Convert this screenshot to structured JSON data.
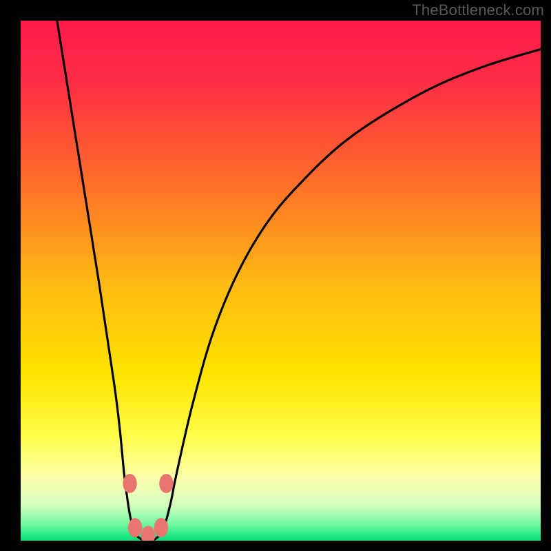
{
  "watermark": "TheBottleneck.com",
  "chart_data": {
    "type": "line",
    "title": "",
    "xlabel": "",
    "ylabel": "",
    "xlim": [
      0,
      100
    ],
    "ylim": [
      0,
      100
    ],
    "grid": false,
    "series": [
      {
        "name": "curve",
        "x": [
          7.0,
          11.0,
          15.0,
          18.0,
          19.0,
          19.5,
          20.0,
          21.0,
          22.0,
          23.0,
          24.0,
          25.0,
          26.0,
          27.0,
          28.0,
          29.0,
          30.0,
          33.0,
          37.0,
          42.0,
          48.0,
          55.0,
          62.0,
          70.0,
          80.0,
          90.0,
          100.0
        ],
        "y": [
          100.0,
          75.0,
          50.0,
          30.0,
          22.0,
          17.0,
          12.0,
          5.0,
          1.5,
          0.4,
          0.0,
          0.0,
          0.4,
          1.5,
          4.0,
          8.0,
          13.0,
          26.0,
          40.0,
          52.0,
          62.0,
          70.0,
          76.5,
          82.0,
          87.5,
          91.5,
          94.5
        ]
      }
    ],
    "markers": [
      {
        "x": 21.0,
        "y": 11.0
      },
      {
        "x": 22.0,
        "y": 2.5
      },
      {
        "x": 24.5,
        "y": 1.0
      },
      {
        "x": 27.0,
        "y": 2.5
      },
      {
        "x": 28.0,
        "y": 11.0
      }
    ],
    "background_gradient": {
      "stops": [
        {
          "offset": 0.0,
          "color": "#ff1a4b"
        },
        {
          "offset": 0.12,
          "color": "#ff2e45"
        },
        {
          "offset": 0.3,
          "color": "#ff6a2b"
        },
        {
          "offset": 0.5,
          "color": "#ffb814"
        },
        {
          "offset": 0.68,
          "color": "#ffe400"
        },
        {
          "offset": 0.8,
          "color": "#fffd4a"
        },
        {
          "offset": 0.88,
          "color": "#fbffab"
        },
        {
          "offset": 0.93,
          "color": "#d6ffc0"
        },
        {
          "offset": 0.97,
          "color": "#6cf79e"
        },
        {
          "offset": 1.0,
          "color": "#00e07a"
        }
      ]
    }
  }
}
